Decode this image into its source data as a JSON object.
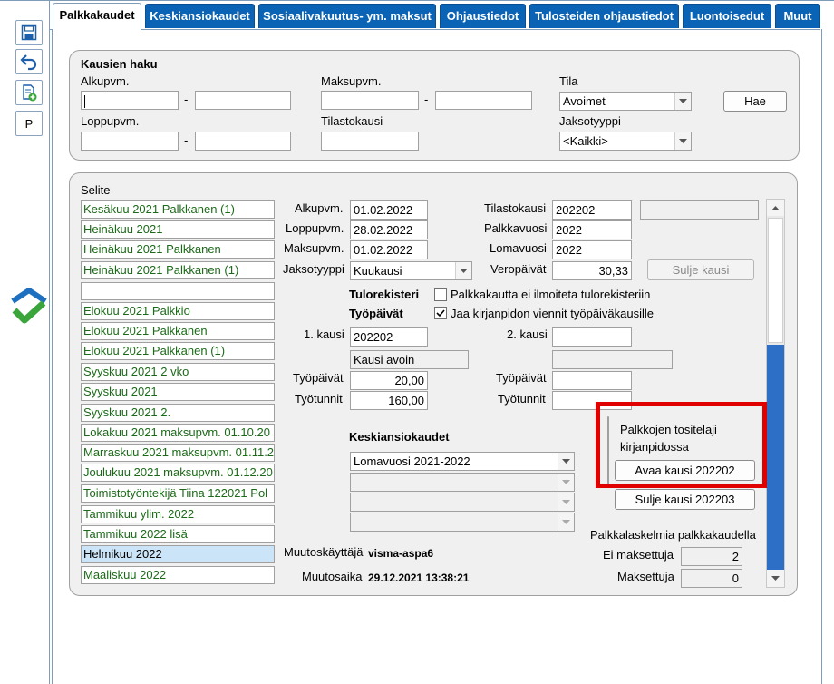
{
  "toolbar": {
    "p_label": "P"
  },
  "tabs": [
    {
      "label": "Palkkakaudet"
    },
    {
      "label": "Keskiansiokaudet"
    },
    {
      "label": "Sosiaalivakuutus- ym. maksut"
    },
    {
      "label": "Ohjaustiedot"
    },
    {
      "label": "Tulosteiden ohjaustiedot"
    },
    {
      "label": "Luontoisedut"
    },
    {
      "label": "Muut"
    }
  ],
  "search": {
    "title": "Kausien haku",
    "alkupvm_label": "Alkupvm.",
    "maksupvm_label": "Maksupvm.",
    "tila_label": "Tila",
    "tila_value": "Avoimet",
    "loppupvm_label": "Loppupvm.",
    "tilastokausi_label": "Tilastokausi",
    "jaksotyyppi_label": "Jaksotyyppi",
    "jaksotyyppi_value": "<Kaikki>",
    "dash": "-",
    "search_button": "Hae"
  },
  "periods": {
    "list_label": "Selite",
    "items": [
      "Kesäkuu 2021 Palkkanen (1)",
      "Heinäkuu 2021",
      "Heinäkuu 2021 Palkkanen",
      "Heinäkuu 2021 Palkkanen (1)",
      "",
      "Elokuu 2021 Palkkio",
      "Elokuu 2021 Palkkanen",
      "Elokuu 2021 Palkkanen (1)",
      "Syyskuu 2021 2 vko",
      "Syyskuu 2021",
      "Syyskuu 2021 2.",
      "Lokakuu 2021 maksupvm. 01.10.20",
      "Marraskuu 2021 maksupvm. 01.11.2",
      "Joulukuu 2021 maksupvm. 01.12.20",
      "Toimistotyöntekijä Tiina 122021 Pol",
      "Tammikuu ylim. 2022",
      "Tammikuu 2022 lisä",
      "Helmikuu 2022",
      "Maaliskuu 2022"
    ],
    "selected_index": 17
  },
  "detail": {
    "alkupvm_label": "Alkupvm.",
    "alkupvm": "01.02.2022",
    "loppupvm_label": "Loppupvm.",
    "loppupvm": "28.02.2022",
    "maksupvm_label": "Maksupvm.",
    "maksupvm": "01.02.2022",
    "jaksotyyppi_label": "Jaksotyyppi",
    "jaksotyyppi": "Kuukausi",
    "tilastokausi_label": "Tilastokausi",
    "tilastokausi": "202202",
    "palkkavuosi_label": "Palkkavuosi",
    "palkkavuosi": "2022",
    "lomavuosi_label": "Lomavuosi",
    "lomavuosi": "2022",
    "veropaivat_label": "Veropäivät",
    "veropaivat": "30,33",
    "sulje_kausi_button": "Sulje kausi",
    "tulorekisteri_label": "Tulorekisteri",
    "tulorekisteri_checkbox": "Palkkakautta ei ilmoiteta tulorekisteriin",
    "tyopaivat_header": "Työpäivät",
    "jaa_checkbox": "Jaa kirjanpidon viennit työpäiväkausille",
    "kausi1_label": "1. kausi",
    "kausi1": "202202",
    "kausi1_status": "Kausi avoin",
    "kausi2_label": "2. kausi",
    "tyopaivat_label": "Työpäivät",
    "tyopaivat1": "20,00",
    "tyotunnit_label": "Työtunnit",
    "tyotunnit1": "160,00",
    "tyopaivat2_label": "Työpäivät",
    "tyotunnit2_label": "Työtunnit",
    "keskiansio_label": "Keskiansiokaudet",
    "keskiansio_value": "Lomavuosi 2021-2022",
    "tosite_title": "Palkkojen tositelaji kirjanpidossa",
    "avaa_button": "Avaa kausi 202202",
    "sulje_button": "Sulje kausi 202203",
    "palkkalaskelmia_label": "Palkkalaskelmia palkkakaudella",
    "ei_maksettuja_label": "Ei maksettuja",
    "ei_maksettuja": "2",
    "maksettuja_label": "Maksettuja",
    "maksettuja": "0",
    "muutoskayttaja_label": "Muutoskäyttäjä",
    "muutoskayttaja": "visma-aspa6",
    "muutosaika_label": "Muutosaika",
    "muutosaika": "29.12.2021 13:38:21"
  },
  "colors": {
    "tab_blue": "#0a63b4",
    "list_green": "#1b6a18",
    "highlight_red": "#e00000"
  }
}
